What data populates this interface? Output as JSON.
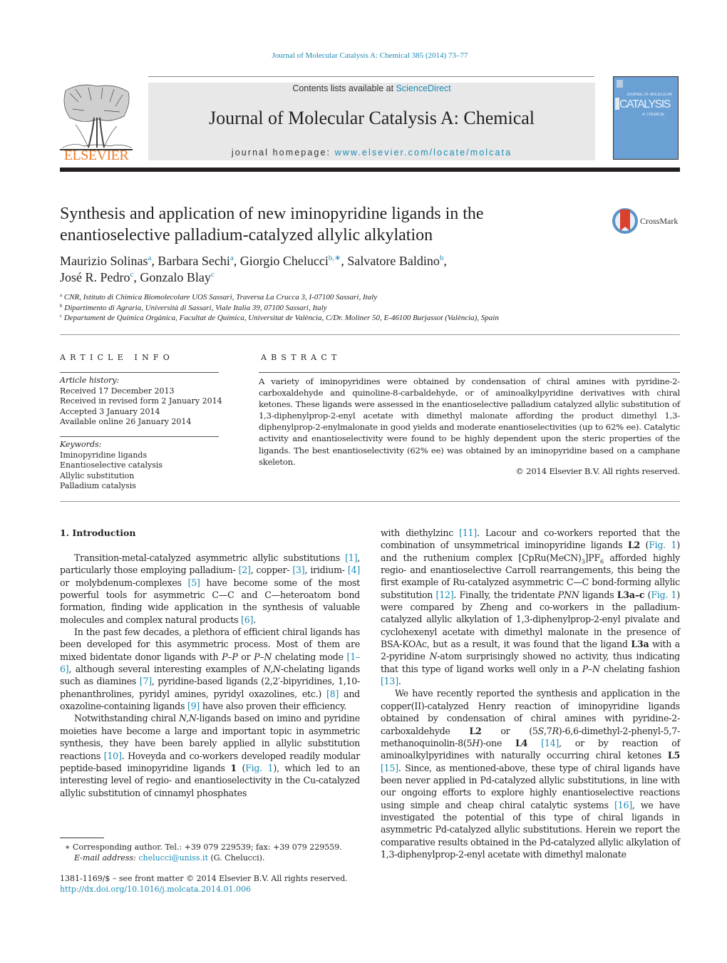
{
  "citation": "Journal of Molecular Catalysis A: Chemical 385 (2014) 73–77",
  "publisher": {
    "logo_icon": "elsevier-tree-icon",
    "name": "ELSEVIER"
  },
  "masthead": {
    "contents_prefix": "Contents lists available at ",
    "contents_link": "ScienceDirect",
    "journal_name": "Journal of Molecular Catalysis A: Chemical",
    "homepage_prefix": "journal homepage: ",
    "homepage_link": "www.elsevier.com/locate/molcata"
  },
  "cover": {
    "title": "CATALYSIS",
    "top_text": "JOURNAL OF MOLECULAR",
    "sub_text": "A: CHEMICAL",
    "bg_color": "#6aa0d4"
  },
  "article": {
    "title": "Synthesis and application of new iminopyridine ligands in the enantioselective palladium-catalyzed allylic alkylation",
    "crossmark_label": "CrossMark",
    "authors": [
      {
        "name": "Maurizio Solinas",
        "aff": "a",
        "sep": ", "
      },
      {
        "name": "Barbara Sechi",
        "aff": "a",
        "sep": ", "
      },
      {
        "name": "Giorgio Chelucci",
        "aff": "b,∗",
        "sep": ", "
      },
      {
        "name": "Salvatore Baldino",
        "aff": "b",
        "sep": ","
      },
      {
        "name": "José R. Pedro",
        "aff": "c",
        "sep": ", "
      },
      {
        "name": "Gonzalo Blay",
        "aff": "c",
        "sep": ""
      }
    ],
    "affiliations": [
      {
        "key": "a",
        "text": "CNR, Istituto di Chimica Biomolecolare UOS Sassari, Traversa La Crucca 3, I-07100 Sassari, Italy"
      },
      {
        "key": "b",
        "text": "Dipartimento di Agraria, Università di Sassari, Viale Italia 39, 07100 Sassari, Italy"
      },
      {
        "key": "c",
        "text": "Departament de Química Orgànica, Facultat de Química, Universitat de València, C/Dr. Moliner 50, E-46100 Burjassot (València), Spain"
      }
    ]
  },
  "article_info": {
    "heading": "ARTICLE INFO",
    "history_label": "Article history:",
    "history": [
      "Received 17 December 2013",
      "Received in revised form 2 January 2014",
      "Accepted 3 January 2014",
      "Available online 26 January 2014"
    ],
    "keywords_label": "Keywords:",
    "keywords": [
      "Iminopyridine ligands",
      "Enantioselective catalysis",
      "Allylic substitution",
      "Palladium catalysis"
    ]
  },
  "abstract": {
    "heading": "ABSTRACT",
    "text": "A variety of iminopyridines were obtained by condensation of chiral amines with pyridine-2-carboxaldehyde and quinoline-8-carbaldehyde, or of aminoalkylpyridine derivatives with chiral ketones. These ligands were assessed in the enantioselective palladium catalyzed allylic substitution of 1,3-diphenylprop-2-enyl acetate with dimethyl malonate affording the product dimethyl 1,3-diphenylprop-2-enylmalonate in good yields and moderate enantioselectivities (up to 62% ee). Catalytic activity and enantioselectivity were found to be highly dependent upon the steric properties of the ligands. The best enantioselectivity (62% ee) was obtained by an iminopyridine based on a camphane skeleton.",
    "copyright": "© 2014 Elsevier B.V. All rights reserved."
  },
  "intro": {
    "heading": "1.  Introduction",
    "left_paragraphs": [
      [
        {
          "t": "Transition-metal-catalyzed asymmetric allylic substitutions "
        },
        {
          "t": "[1]",
          "link": true
        },
        {
          "t": ", particularly those employing palladium- "
        },
        {
          "t": "[2]",
          "link": true
        },
        {
          "t": ", copper- "
        },
        {
          "t": "[3]",
          "link": true
        },
        {
          "t": ", iridium- "
        },
        {
          "t": "[4]",
          "link": true
        },
        {
          "t": " or molybdenum-complexes "
        },
        {
          "t": "[5]",
          "link": true
        },
        {
          "t": " have become some of the most powerful tools for asymmetric C—C and C—heteroatom bond formation, finding wide application in the synthesis of valuable molecules and complex natural products "
        },
        {
          "t": "[6]",
          "link": true
        },
        {
          "t": "."
        }
      ],
      [
        {
          "t": "In the past few decades, a plethora of efficient chiral ligands has been developed for this asymmetric process. Most of them are mixed bidentate donor ligands with "
        },
        {
          "t": "P–P",
          "i": true
        },
        {
          "t": " or "
        },
        {
          "t": "P–N",
          "i": true
        },
        {
          "t": " chelating mode "
        },
        {
          "t": "[1–6]",
          "link": true
        },
        {
          "t": ", although several interesting examples of "
        },
        {
          "t": "N,N",
          "i": true
        },
        {
          "t": "-chelating ligands such as diamines "
        },
        {
          "t": "[7]",
          "link": true
        },
        {
          "t": ", pyridine-based ligands (2,2′-bipyridines, 1,10-phenanthrolines, pyridyl amines, pyridyl oxazolines, etc.) "
        },
        {
          "t": "[8]",
          "link": true
        },
        {
          "t": " and oxazoline-containing ligands "
        },
        {
          "t": "[9]",
          "link": true
        },
        {
          "t": " have also proven their efficiency."
        }
      ],
      [
        {
          "t": "Notwithstanding chiral "
        },
        {
          "t": "N,N",
          "i": true
        },
        {
          "t": "-ligands based on imino and pyridine moieties have become a large and important topic in asymmetric synthesis, they have been barely applied in allylic substitution reactions "
        },
        {
          "t": "[10]",
          "link": true
        },
        {
          "t": ". Hoveyda and co-workers developed readily modular peptide-based iminopyridine ligands "
        },
        {
          "t": "1",
          "b": true
        },
        {
          "t": " ("
        },
        {
          "t": "Fig. 1",
          "link": true
        },
        {
          "t": "), which led to an interesting level of regio- and enantioselectivity in the Cu-catalyzed allylic substitution of cinnamyl phosphates"
        }
      ]
    ],
    "right_paragraphs": [
      [
        {
          "t": "with diethylzinc "
        },
        {
          "t": "[11]",
          "link": true
        },
        {
          "t": ". Lacour and co-workers reported that the combination of unsymmetrical iminopyridine ligands "
        },
        {
          "t": "L2",
          "b": true
        },
        {
          "t": " ("
        },
        {
          "t": "Fig. 1",
          "link": true
        },
        {
          "t": ") and the ruthenium complex [CpRu(MeCN)"
        },
        {
          "t": "3",
          "sub": true
        },
        {
          "t": "]PF"
        },
        {
          "t": "6",
          "sub": true
        },
        {
          "t": " afforded highly regio- and enantioselective Carroll rearrangements, this being the first example of Ru-catalyzed asymmetric C—C bond-forming allylic substitution "
        },
        {
          "t": "[12]",
          "link": true
        },
        {
          "t": ". Finally, the tridentate "
        },
        {
          "t": "PNN",
          "i": true
        },
        {
          "t": " ligands "
        },
        {
          "t": "L3a–c",
          "b": true
        },
        {
          "t": " ("
        },
        {
          "t": "Fig. 1",
          "link": true
        },
        {
          "t": ") were compared by Zheng and co-workers in the palladium-catalyzed allylic alkylation of 1,3-diphenylprop-2-enyl pivalate and cyclohexenyl acetate with dimethyl malonate in the presence of BSA-KOAc, but as a result, it was found that the ligand "
        },
        {
          "t": "L3a",
          "b": true
        },
        {
          "t": " with a 2-pyridine "
        },
        {
          "t": "N",
          "i": true
        },
        {
          "t": "-atom surprisingly showed no activity, thus indicating that this type of ligand works well only in a "
        },
        {
          "t": "P–N",
          "i": true
        },
        {
          "t": " chelating fashion "
        },
        {
          "t": "[13]",
          "link": true
        },
        {
          "t": "."
        }
      ],
      [
        {
          "t": "We have recently reported the synthesis and application in the copper(II)-catalyzed Henry reaction of iminopyridine ligands obtained by condensation of chiral amines with pyridine-2-carboxaldehyde "
        },
        {
          "t": "L2",
          "b": true
        },
        {
          "t": " or (5"
        },
        {
          "t": "S",
          "i": true
        },
        {
          "t": ",7"
        },
        {
          "t": "R",
          "i": true
        },
        {
          "t": ")-6,6-dimethyl-2-phenyl-5,7-methanoquinolin-8(5"
        },
        {
          "t": "H",
          "i": true
        },
        {
          "t": ")-one "
        },
        {
          "t": "L4",
          "b": true
        },
        {
          "t": " "
        },
        {
          "t": "[14]",
          "link": true
        },
        {
          "t": ", or by reaction of aminoalkylpyridines with naturally occurring chiral ketones "
        },
        {
          "t": "L5",
          "b": true
        },
        {
          "t": " "
        },
        {
          "t": "[15]",
          "link": true
        },
        {
          "t": ". Since, as mentioned-above, these type of chiral ligands have been never applied in Pd-catalyzed allylic substitutions, in line with our ongoing efforts to explore highly enantioselective reactions using simple and cheap chiral catalytic systems "
        },
        {
          "t": "[16]",
          "link": true
        },
        {
          "t": ", we have investigated the potential of this type of chiral ligands in asymmetric Pd-catalyzed allylic substitutions. Herein we report the comparative results obtained in the Pd-catalyzed allylic alkylation of 1,3-diphenylprop-2-enyl acetate with dimethyl malonate"
        }
      ]
    ]
  },
  "footnote": {
    "marker": "∗",
    "corresponding": " Corresponding author. Tel.: +39 079 229539; fax: +39 079 229559.",
    "email_label": "E-mail address:",
    "email": "chelucci@uniss.it",
    "email_suffix": " (G. Chelucci)."
  },
  "front_matter": {
    "issn_line": "1381-1169/$ – see front matter © 2014 Elsevier B.V. All rights reserved.",
    "doi": "http://dx.doi.org/10.1016/j.molcata.2014.01.006"
  },
  "colors": {
    "link": "#1a8ab4",
    "elsevier_orange": "#f07c2a",
    "masthead_bg": "#e8e8e8",
    "crossmark_red": "#d9402e",
    "crossmark_ring": "#3b7fbf"
  }
}
